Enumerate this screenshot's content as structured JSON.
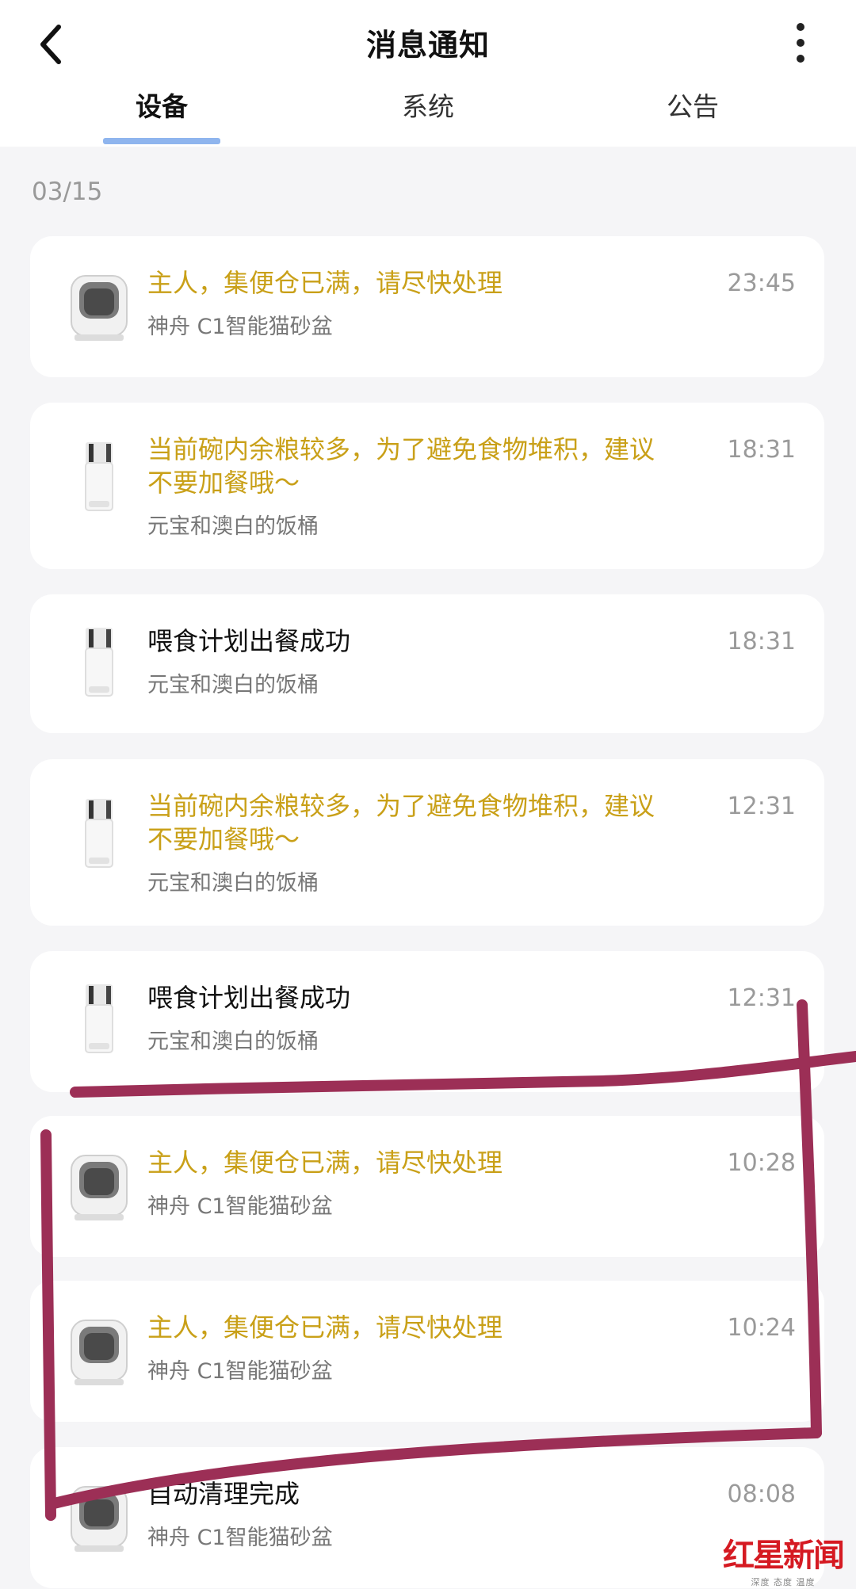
{
  "header": {
    "title": "消息通知"
  },
  "tabs": [
    {
      "label": "设备",
      "active": true
    },
    {
      "label": "系统",
      "active": false
    },
    {
      "label": "公告",
      "active": false
    }
  ],
  "date_label": "03/15",
  "colors": {
    "warning_text": "#c9a018",
    "tab_indicator": "#8fb5ee",
    "annotation": "#9c2f56"
  },
  "messages": [
    {
      "icon": "litter-box-icon",
      "lines": [
        "主人，集便仓已满，请尽快处理"
      ],
      "device": "神舟 C1智能猫砂盆",
      "time": "23:45",
      "warning": true
    },
    {
      "icon": "feeder-icon",
      "lines": [
        "当前碗内余粮较多，为了避免食物堆积，建议",
        "不要加餐哦～"
      ],
      "device": "元宝和澳白的饭桶",
      "time": "18:31",
      "warning": true
    },
    {
      "icon": "feeder-icon",
      "lines": [
        "喂食计划出餐成功"
      ],
      "device": "元宝和澳白的饭桶",
      "time": "18:31",
      "warning": false
    },
    {
      "icon": "feeder-icon",
      "lines": [
        "当前碗内余粮较多，为了避免食物堆积，建议",
        "不要加餐哦～"
      ],
      "device": "元宝和澳白的饭桶",
      "time": "12:31",
      "warning": true
    },
    {
      "icon": "feeder-icon",
      "lines": [
        "喂食计划出餐成功"
      ],
      "device": "元宝和澳白的饭桶",
      "time": "12:31",
      "warning": false
    },
    {
      "icon": "litter-box-icon",
      "lines": [
        "主人，集便仓已满，请尽快处理"
      ],
      "device": "神舟 C1智能猫砂盆",
      "time": "10:28",
      "warning": true
    },
    {
      "icon": "litter-box-icon",
      "lines": [
        "主人，集便仓已满，请尽快处理"
      ],
      "device": "神舟 C1智能猫砂盆",
      "time": "10:24",
      "warning": true
    },
    {
      "icon": "litter-box-icon",
      "lines": [
        "自动清理完成"
      ],
      "device": "神舟 C1智能猫砂盆",
      "time": "08:08",
      "warning": false
    }
  ],
  "watermark": {
    "name": "红星新闻",
    "tagline": "深度 态度 温度"
  }
}
